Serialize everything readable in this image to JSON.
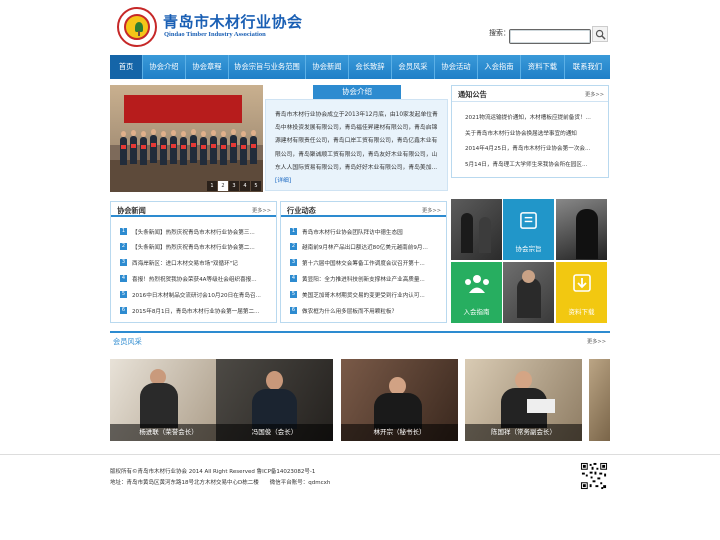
{
  "header": {
    "title": "青岛市木材行业协会",
    "subtitle": "Qindao Timber Industry Association",
    "search_label": "搜索：",
    "search_value": ""
  },
  "nav": [
    {
      "label": "首页",
      "active": true
    },
    {
      "label": "协会介绍"
    },
    {
      "label": "协会章程"
    },
    {
      "label": "协会宗旨与业务范围"
    },
    {
      "label": "协会新闻"
    },
    {
      "label": "会长致辞"
    },
    {
      "label": "会员风采"
    },
    {
      "label": "协会活动"
    },
    {
      "label": "入会指南"
    },
    {
      "label": "资料下载"
    },
    {
      "label": "联系我们"
    }
  ],
  "banner": {
    "pages": [
      "1",
      "2",
      "3",
      "4",
      "5"
    ],
    "active_page": "2"
  },
  "intro": {
    "tab": "协会介绍",
    "text": "青岛市木材行业协会成立于2013年12月底，由10家发起单位青岛中林投资发展有限公司，青岛福佳昇建材有限公司，青岛启锦源建材有限责任公司，青岛口岸工贸有限公司，青岛亿鑫木业有限公司，青岛聚诚顺工贸有限公司，青岛友好木业有限公司，山东人人国际贸易有限公司，青岛好好木业有限公司，青岛美加...",
    "more": "[详细]"
  },
  "notice": {
    "title": "通知公告",
    "more": "更多>>",
    "items": [
      "2021物流运输提价通知，木材槽板应提前备货！...",
      "关于青岛市木材行业协会换届选举事宜的通知",
      "2014年4月25日，青岛市木材行业协会第一次会...",
      "5月14日，青岛理工大学师生来我协会所在园区..."
    ]
  },
  "news": {
    "title": "协会新闻",
    "more": "更多>>",
    "items": [
      "【头条新闻】热烈庆祝青岛市木材行业协会第三...",
      "【头条新闻】热烈庆祝青岛市木材行业协会第二...",
      "西海岸新区：进口木材交易市场\"双循环\"记",
      "喜报！热烈祝贺我协会荣获4A等级社会组织喜报...",
      "2016中日木材制品交流研讨会10月20日在青岛召...",
      "2015年8月1日，青岛市木材行业协会第一届第二..."
    ]
  },
  "industry": {
    "title": "行业动态",
    "more": "更多>>",
    "items": [
      "青岛市木材行业协会团队拜访中德生态园",
      "越南前9月林产品出口额达近80亿美元越南前9月...",
      "第十六届中国林交会筹备工作调度会议召开第十...",
      "黄显阳：全力推进科技创新支撑林业产业高质量...",
      "美国芝加哥木材期货交易的变更受到行业内认可...",
      "做农框为什么用多层板而不用颗粒板？"
    ]
  },
  "tiles": {
    "purpose": "协会宗旨",
    "guide": "入会指南",
    "download": "资料下载"
  },
  "members": {
    "title": "会员风采",
    "more": "更多>>",
    "items": [
      "杨进联（荣誉会长）",
      "冯国俊（会长）",
      "林开宗（秘书长）",
      "陈国祥（常务副会长）"
    ]
  },
  "footer": {
    "line1": "版权所有©青岛市木材行业协会 2014 All Right Reserved 鲁ICP备14023082号-1",
    "line2": "地址：青岛市黄岛区黄河东路18号北方木材交易中心D栋二楼　　微信平台账号：qdmcxh"
  },
  "colors": {
    "brand_blue": "#2d8bd0",
    "title_blue": "#1a5fb4",
    "tile_blue": "#2196c9",
    "tile_green": "#27ae60",
    "tile_yellow": "#f2c811"
  }
}
